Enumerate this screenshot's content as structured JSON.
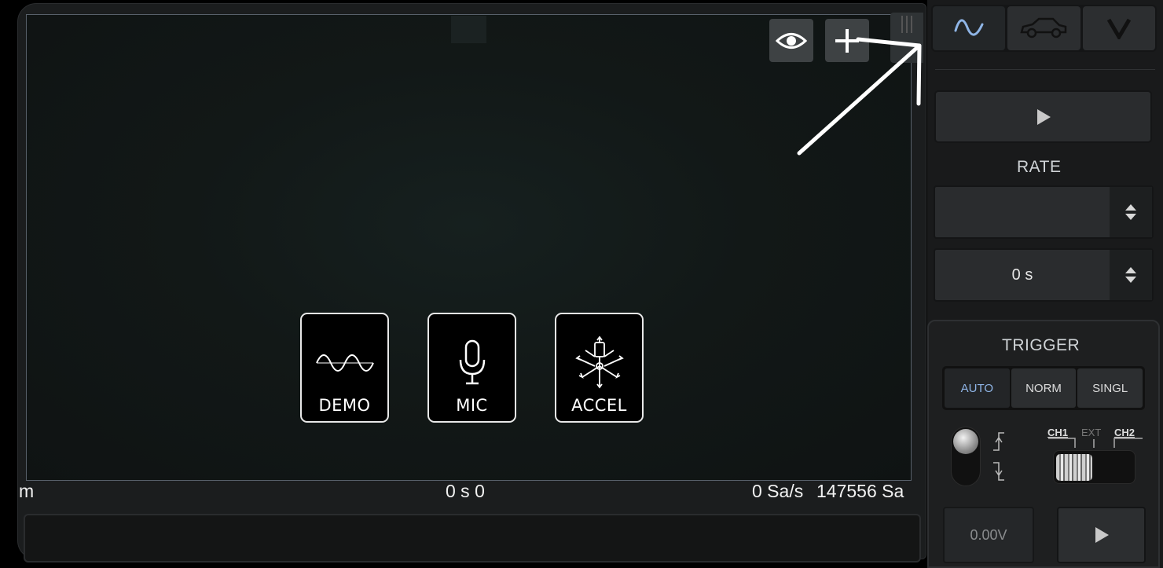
{
  "screen": {
    "sources": [
      {
        "label": "DEMO",
        "icon": "sine-wave-icon"
      },
      {
        "label": "MIC",
        "icon": "microphone-icon"
      },
      {
        "label": "ACCEL",
        "icon": "accelerometer-icon"
      }
    ],
    "toolbar": {
      "view_icon": "eye-icon",
      "add_icon": "plus-icon"
    }
  },
  "status": {
    "left": "m",
    "center": "0 s 0",
    "rate": "0 Sa/s",
    "samples": "147556 Sa"
  },
  "panel": {
    "modes": [
      {
        "icon": "waveform-icon",
        "active": true
      },
      {
        "icon": "car-icon",
        "active": false
      },
      {
        "icon": "voltage-icon",
        "active": false
      }
    ],
    "rate_label": "RATE",
    "rate_value": "",
    "time_value": "0 s",
    "trigger": {
      "title": "TRIGGER",
      "tabs": [
        "AUTO",
        "NORM",
        "SINGL"
      ],
      "active_tab": "AUTO",
      "channels": [
        "CH1",
        "EXT",
        "CH2"
      ],
      "level": "0.00V"
    }
  },
  "colors": {
    "accent": "#8fb5e6",
    "background": "#1b1d1e"
  }
}
